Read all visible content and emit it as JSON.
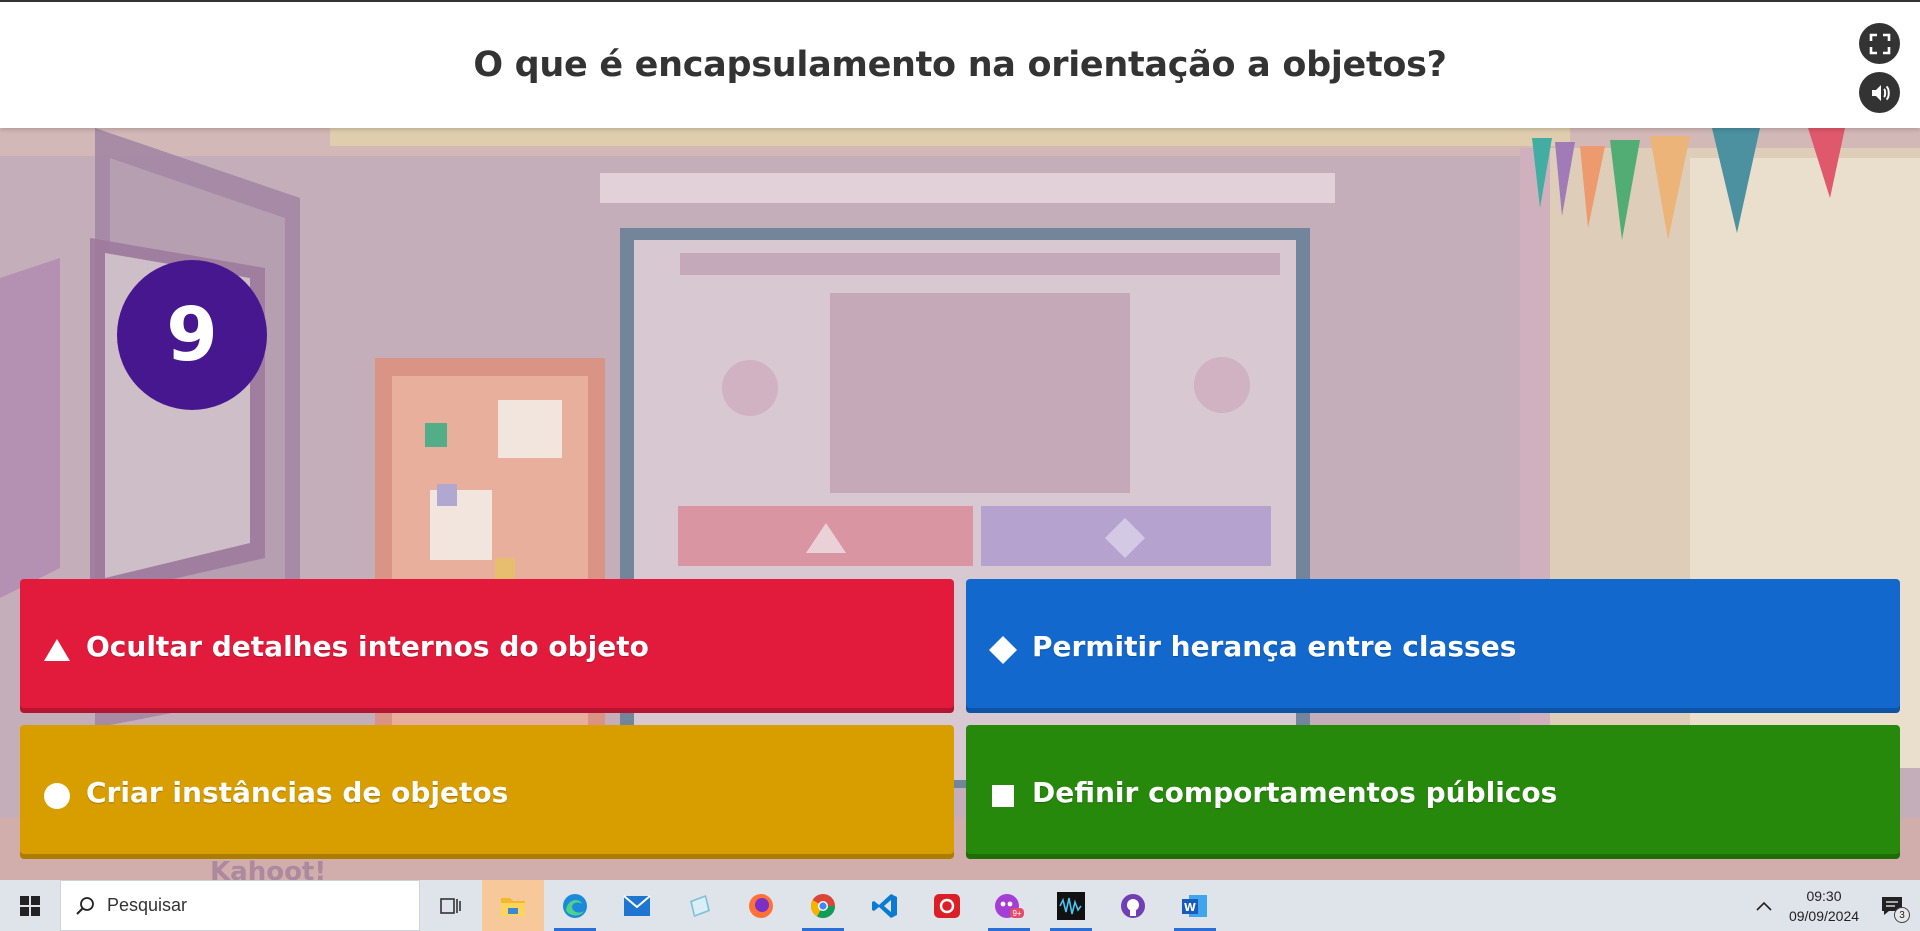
{
  "question": {
    "title": "O que é encapsulamento na orientação a objetos?",
    "fullscreen_icon": "fullscreen-icon",
    "sound_icon": "sound-icon"
  },
  "countdown": {
    "value": "9"
  },
  "answers": [
    {
      "label": "Ocultar detalhes internos do objeto",
      "shape": "triangle",
      "color": "#e21b3c"
    },
    {
      "label": "Permitir herança entre classes",
      "shape": "diamond",
      "color": "#1368ce"
    },
    {
      "label": "Criar instâncias de objetos",
      "shape": "circle",
      "color": "#d89e00"
    },
    {
      "label": "Definir comportamentos públicos",
      "shape": "square",
      "color": "#26890c"
    }
  ],
  "background": {
    "watermark": "Kahoot!"
  },
  "taskbar": {
    "search_placeholder": "Pesquisar",
    "apps": [
      "task-view",
      "file-explorer",
      "edge",
      "mail",
      "notepad",
      "firefox",
      "chrome",
      "vscode",
      "creative-cloud",
      "game-bar",
      "audio-app",
      "github-desktop",
      "word"
    ],
    "game_badge": "9+",
    "time": "09:30",
    "date": "09/09/2024",
    "notifications": "3"
  }
}
